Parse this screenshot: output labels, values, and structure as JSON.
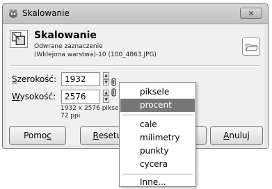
{
  "dialog": {
    "title": "Skalowanie",
    "close_glyph": "✕",
    "header": {
      "title": "Skalowanie",
      "line1": "Odwrane zaznaczenie",
      "line2": "(Wklejona warstwa)-10 (100_4863.JPG)"
    },
    "width": {
      "label_first": "S",
      "label_rest": "zerokość:",
      "value": "1932"
    },
    "height": {
      "label_first": "W",
      "label_rest": "ysokość:",
      "value": "2576"
    },
    "size_info": "1932 x 2576 pikseli",
    "resolution_info": "72 ppi",
    "buttons": {
      "help_prefix": "Pomo",
      "help_accel": "c",
      "reset_accel": "R",
      "reset_rest": "esetuj",
      "cancel_accel": "A",
      "cancel_rest": "nuluj"
    }
  },
  "unit_menu": {
    "group1": [
      "piksele",
      "procent"
    ],
    "group2": [
      "cale",
      "milimetry",
      "punkty",
      "cycera"
    ],
    "group3": [
      "Inne..."
    ],
    "selected": "procent"
  },
  "colors": {
    "selection": "#777777",
    "window_bg": "#f0f0f0"
  },
  "icons": {
    "app": "gimp-wilber-icon",
    "header": "scale-tool-icon",
    "preview": "preview-image-icon",
    "chain": "chain-link-icon",
    "spin": "spin-arrows-icon"
  }
}
